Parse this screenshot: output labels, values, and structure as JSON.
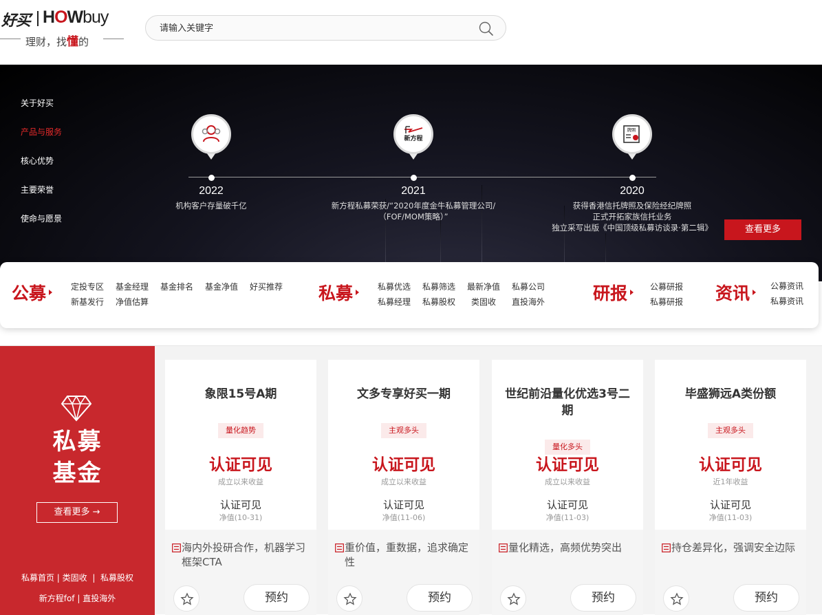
{
  "header": {
    "logo": {
      "cn": "好买",
      "en_a": "H",
      "en_o": "O",
      "en_b": "W",
      "en_c": "buy",
      "tagline_a": "理财，找",
      "tagline_b": "懂",
      "tagline_c": "的"
    },
    "search": {
      "placeholder": "请输入关键字",
      "icon": "search-icon"
    }
  },
  "hero": {
    "side_nav": [
      {
        "label": "关于好买",
        "active": false
      },
      {
        "label": "产品与服务",
        "active": true
      },
      {
        "label": "核心优势",
        "active": false
      },
      {
        "label": "主要荣誉",
        "active": false
      },
      {
        "label": "使命与愿景",
        "active": false
      }
    ],
    "milestones": [
      {
        "year": "2022",
        "icon": "users-icon",
        "lines": [
          "机构客户存量破千亿"
        ]
      },
      {
        "year": "2021",
        "icon": "newfangcheng-logo-icon",
        "icon_text": "新方程",
        "lines": [
          "新方程私募荣获/“2020年度金牛私募管理公司/",
          "（FOF/MOM策略）”"
        ]
      },
      {
        "year": "2020",
        "icon": "license-icon",
        "icon_text": "牌照",
        "lines": [
          "获得香港信托牌照及保险经纪牌照",
          "正式开拓家族信托业务",
          "独立采写出版《中国顶级私募访谈录·第二辑》"
        ]
      }
    ],
    "more_label": "查看更多"
  },
  "categories": [
    {
      "title": "公募",
      "links": [
        "定投专区",
        "基金经理",
        "基金排名",
        "基金净值",
        "好买推荐",
        "新基发行",
        "净值估算"
      ]
    },
    {
      "title": "私募",
      "links": [
        "私募优选",
        "私募筛选",
        "最新净值",
        "私募公司",
        "私募经理",
        "私募股权",
        "类固收",
        "直投海外"
      ]
    },
    {
      "title": "研报",
      "links": [
        "公募研报",
        "私募研报"
      ]
    },
    {
      "title": "资讯",
      "links": [
        "公募资讯",
        "私募资讯"
      ]
    }
  ],
  "private_fund": {
    "title_1": "私募",
    "title_2": "基金",
    "more_label": "查看更多 →",
    "links_1": [
      "私募首页",
      "类固收",
      "私募股权"
    ],
    "links_2": [
      "新方程fof",
      "直投海外"
    ],
    "separator": "|"
  },
  "products": [
    {
      "name": "象限15号A期",
      "tag": "量化趋势",
      "return": "认证可见",
      "return_label": "成立以来收益",
      "nav": "认证可见",
      "nav_label": "净值(10-31)",
      "desc": "海内外投研合作，机器学习框架CTA",
      "book": "预约"
    },
    {
      "name": "文多专享好买一期",
      "tag": "主观多头",
      "return": "认证可见",
      "return_label": "成立以来收益",
      "nav": "认证可见",
      "nav_label": "净值(11-06)",
      "desc": "重价值，重数据，追求确定性",
      "book": "预约"
    },
    {
      "name": "世纪前沿量化优选3号二期",
      "tag": "量化多头",
      "return": "认证可见",
      "return_label": "成立以来收益",
      "nav": "认证可见",
      "nav_label": "净值(11-03)",
      "desc": "量化精选，高频优势突出",
      "book": "预约"
    },
    {
      "name": "毕盛狮远A类份额",
      "tag": "主观多头",
      "return": "认证可见",
      "return_label": "近1年收益",
      "nav": "认证可见",
      "nav_label": "净值(11-03)",
      "desc": "持仓差异化，强调安全边际",
      "book": "预约"
    }
  ],
  "colors": {
    "brand_red": "#c8161d",
    "panel_red": "#c8282d",
    "hero_bg": "#000000"
  }
}
